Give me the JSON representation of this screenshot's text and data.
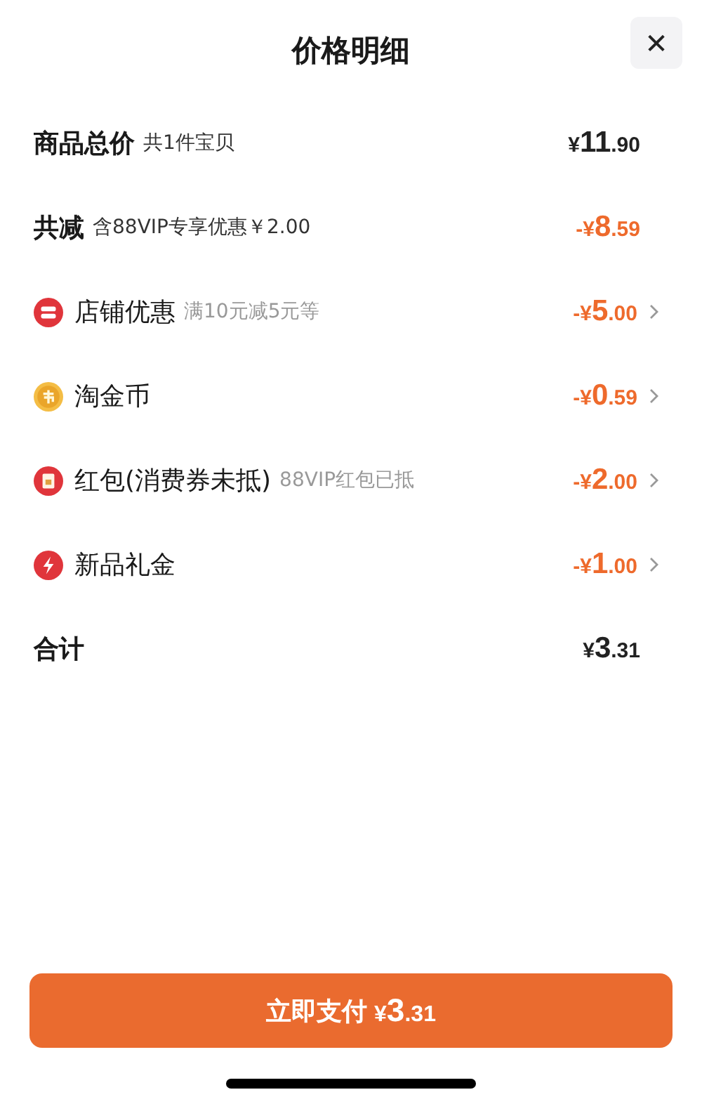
{
  "header": {
    "title": "价格明细",
    "close": "✕"
  },
  "rows": [
    {
      "kind": "total",
      "label": "商品总价",
      "note": "共1件宝贝",
      "amount": {
        "prefix": "¥",
        "major": "11",
        "minor": ".90"
      },
      "deduction": false,
      "chevron": false
    },
    {
      "kind": "total",
      "label": "共减",
      "note": "含88VIP专享优惠￥2.00",
      "amount": {
        "prefix": "-¥",
        "major": "8",
        "minor": ".59"
      },
      "deduction": true,
      "chevron": false
    },
    {
      "kind": "shop",
      "label": "店铺优惠",
      "note": "满10元减5元等",
      "amount": {
        "prefix": "-¥",
        "major": "5",
        "minor": ".00"
      },
      "deduction": true,
      "chevron": true
    },
    {
      "kind": "coin",
      "label": "淘金币",
      "amount": {
        "prefix": "-¥",
        "major": "0",
        "minor": ".59"
      },
      "deduction": true,
      "chevron": true
    },
    {
      "kind": "packet",
      "label": "红包(消费券未抵)",
      "note": "88VIP红包已抵",
      "amount": {
        "prefix": "-¥",
        "major": "2",
        "minor": ".00"
      },
      "deduction": true,
      "chevron": true
    },
    {
      "kind": "bolt",
      "label": "新品礼金",
      "amount": {
        "prefix": "-¥",
        "major": "1",
        "minor": ".00"
      },
      "deduction": true,
      "chevron": true
    },
    {
      "kind": "total",
      "label": "合计",
      "amount": {
        "prefix": "¥",
        "major": "3",
        "minor": ".31"
      },
      "deduction": false,
      "chevron": false
    }
  ],
  "pay_button": {
    "label": "立即支付",
    "amount": {
      "prefix": "¥",
      "major": "3",
      "minor": ".31"
    }
  }
}
